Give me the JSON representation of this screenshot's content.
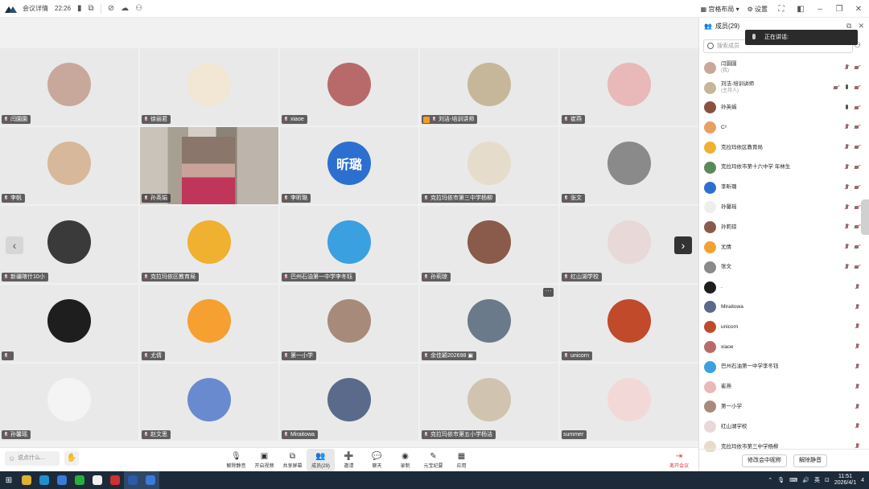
{
  "titlebar": {
    "meeting_details": "会议详情",
    "elapsed": "22:26",
    "layout_label": "宫格布局",
    "settings_label": "设置"
  },
  "grid_tiles": [
    {
      "name": "闫園園",
      "avatar_color": "#c9a89c",
      "mic": "off"
    },
    {
      "name": "徐丽君",
      "avatar_color": "#f2e6d4",
      "mic": "off"
    },
    {
      "name": "xiaoe",
      "avatar_color": "#b86a6a",
      "mic": "off"
    },
    {
      "name": "刘洁-培训讲师",
      "avatar_color": "#c7b79a",
      "mic": "on",
      "host": true
    },
    {
      "name": "崔燕",
      "avatar_color": "#e9b8b8",
      "mic": "off"
    },
    {
      "name": "李帆",
      "avatar_color": "#d8b89a",
      "mic": "off"
    },
    {
      "name": "孙英娟",
      "video": true,
      "mic": "on"
    },
    {
      "name": "李昕璐",
      "avatar_text": "昕璐",
      "mic": "off"
    },
    {
      "name": "克拉玛依市第三中学杨柳",
      "avatar_color": "#e6dccb",
      "mic": "off"
    },
    {
      "name": "张文",
      "avatar_color": "#8a8a8a",
      "mic": "off"
    },
    {
      "name": "新疆喀什10小",
      "avatar_color": "#3a3a3a",
      "mic": "off"
    },
    {
      "name": "克拉玛依区教育局",
      "avatar_color": "#f0b030",
      "mic": "off"
    },
    {
      "name": "巴州石油第一中学李冬钰",
      "avatar_color": "#3aa0e0",
      "mic": "off"
    },
    {
      "name": "孙莉琼",
      "avatar_color": "#8a5a4a",
      "mic": "off"
    },
    {
      "name": "红山湖学校",
      "avatar_color": "#e8d8d8",
      "mic": "off"
    },
    {
      "name": "",
      "avatar_color": "#1e1e1e",
      "mic": "off"
    },
    {
      "name": "尤倩",
      "avatar_color": "#f5a030",
      "mic": "off"
    },
    {
      "name": "第一小学",
      "avatar_color": "#a88a7a",
      "mic": "off"
    },
    {
      "name": "余佳颖202698",
      "avatar_color": "#6a7a8a",
      "mic": "off",
      "share": true
    },
    {
      "name": "unicorn",
      "avatar_color": "#c04a2a",
      "mic": "off"
    },
    {
      "name": "孙馨瑶",
      "avatar_color": "#f4f4f4",
      "mic": "off"
    },
    {
      "name": "赵文思",
      "avatar_color": "#6a8ad0",
      "mic": "off"
    },
    {
      "name": "Miraitowa",
      "avatar_color": "#5a6a8a",
      "mic": "off"
    },
    {
      "name": "克拉玛依市第五小学杨洁",
      "avatar_color": "#d0c4b0",
      "mic": "off"
    },
    {
      "name": "summer",
      "avatar_color": "#f3d8d8",
      "mic": "none"
    }
  ],
  "chat_placeholder": "说点什么...",
  "toolbar": {
    "items": [
      {
        "label": "解除静音",
        "icon": "mic-off-icon",
        "glyph": "🎙"
      },
      {
        "label": "开启视频",
        "icon": "camera-off-icon",
        "glyph": "▣"
      },
      {
        "label": "共享屏幕",
        "icon": "share-screen-icon",
        "glyph": "⧉"
      },
      {
        "label": "成员(29)",
        "icon": "members-icon",
        "glyph": "👥",
        "active": true
      },
      {
        "label": "邀请",
        "icon": "invite-icon",
        "glyph": "➕"
      },
      {
        "label": "聊天",
        "icon": "chat-icon",
        "glyph": "💬"
      },
      {
        "label": "录制",
        "icon": "record-icon",
        "glyph": "◉"
      },
      {
        "label": "元宝纪要",
        "icon": "notes-icon",
        "glyph": "✎"
      },
      {
        "label": "应用",
        "icon": "apps-icon",
        "glyph": "▦"
      }
    ],
    "leave_label": "离开会议"
  },
  "panel": {
    "title": "成员(29)",
    "search_placeholder": "搜索成员",
    "speaking_label": "正在讲话:",
    "members": [
      {
        "name": "闫園園",
        "sub": "(我)",
        "color": "#c9a89c",
        "icons": [
          "mic-off",
          "cam-off"
        ]
      },
      {
        "name": "刘洁-培训讲师",
        "sub": "(主持人)",
        "color": "#c7b79a",
        "icons": [
          "cam-off",
          "mic-on",
          "cam-off"
        ]
      },
      {
        "name": "孙英娟",
        "sub": "",
        "color": "#8a5040",
        "icons": [
          "mic-on",
          "cam-off"
        ]
      },
      {
        "name": "C²",
        "sub": "",
        "color": "#e8a060",
        "icons": [
          "mic-off",
          "cam-off"
        ]
      },
      {
        "name": "克拉玛依区教育局",
        "sub": "",
        "color": "#f0b030",
        "icons": [
          "mic-off",
          "cam-off"
        ]
      },
      {
        "name": "克拉玛依市第十六中学 年林生",
        "sub": "",
        "color": "#5a8a5a",
        "icons": [
          "mic-off",
          "cam-off"
        ]
      },
      {
        "name": "李昕璐",
        "sub": "",
        "color": "#2d6fd0",
        "icons": [
          "mic-off",
          "cam-off"
        ]
      },
      {
        "name": "孙馨瑶",
        "sub": "",
        "color": "#eeeeee",
        "icons": [
          "mic-off",
          "cam-off"
        ]
      },
      {
        "name": "孙莉琼",
        "sub": "",
        "color": "#8a5a4a",
        "icons": [
          "mic-off",
          "cam-off"
        ]
      },
      {
        "name": "尤倩",
        "sub": "",
        "color": "#f5a030",
        "icons": [
          "mic-off",
          "cam-off"
        ]
      },
      {
        "name": "张文",
        "sub": "",
        "color": "#8a8a8a",
        "icons": [
          "mic-off",
          "cam-off"
        ]
      },
      {
        "name": ".",
        "sub": "",
        "color": "#1e1e1e",
        "icons": [
          "mic-off"
        ]
      },
      {
        "name": "Miraitowa",
        "sub": "",
        "color": "#5a6a8a",
        "icons": [
          "mic-off"
        ]
      },
      {
        "name": "unicorn",
        "sub": "",
        "color": "#c04a2a",
        "icons": [
          "mic-off"
        ]
      },
      {
        "name": "xiaoe",
        "sub": "",
        "color": "#b86a6a",
        "icons": [
          "mic-off"
        ]
      },
      {
        "name": "巴州石油第一中学李冬钰",
        "sub": "",
        "color": "#3aa0e0",
        "icons": [
          "mic-off"
        ]
      },
      {
        "name": "崔燕",
        "sub": "",
        "color": "#e9b8b8",
        "icons": [
          "mic-off"
        ]
      },
      {
        "name": "第一小学",
        "sub": "",
        "color": "#a88a7a",
        "icons": [
          "mic-off"
        ]
      },
      {
        "name": "红山湖学校",
        "sub": "",
        "color": "#e8d8d8",
        "icons": [
          "mic-off"
        ]
      },
      {
        "name": "克拉玛依市第三中学杨柳",
        "sub": "",
        "color": "#e6dccb",
        "icons": [
          "mic-off"
        ]
      }
    ],
    "mute_all_label": "修改会中昵称",
    "unmute_all_label": "解除静音"
  },
  "taskbar": {
    "time": "11:51",
    "date": "2026/4/1",
    "ime": "英",
    "notifications": "4",
    "apps": [
      {
        "name": "chrome-icon",
        "color": "#e0b030"
      },
      {
        "name": "edge-icon",
        "color": "#1f8fd0"
      },
      {
        "name": "app-blue-icon",
        "color": "#3a7ad8"
      },
      {
        "name": "wechat-icon",
        "color": "#2aae3a"
      },
      {
        "name": "qq-icon",
        "color": "#f0f0f0"
      },
      {
        "name": "wps-icon",
        "color": "#d03030"
      },
      {
        "name": "meeting-icon",
        "color": "#2a5aa8"
      },
      {
        "name": "feishu-icon",
        "color": "#3a7ad8"
      }
    ]
  }
}
